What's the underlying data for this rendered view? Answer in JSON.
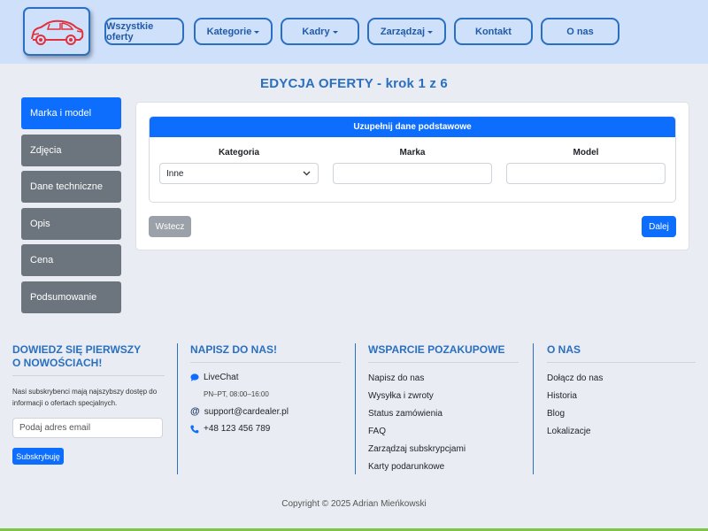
{
  "nav": {
    "items": [
      {
        "label": "Wszystkie oferty",
        "dropdown": false
      },
      {
        "label": "Kategorie",
        "dropdown": true
      },
      {
        "label": "Kadry",
        "dropdown": true
      },
      {
        "label": "Zarządzaj",
        "dropdown": true
      },
      {
        "label": "Kontakt",
        "dropdown": false
      },
      {
        "label": "O nas",
        "dropdown": false
      }
    ]
  },
  "page": {
    "title": "EDYCJA OFERTY - krok 1 z 6"
  },
  "steps": [
    {
      "label": "Marka i model",
      "active": true
    },
    {
      "label": "Zdjęcia",
      "active": false
    },
    {
      "label": "Dane techniczne",
      "active": false
    },
    {
      "label": "Opis",
      "active": false
    },
    {
      "label": "Cena",
      "active": false
    },
    {
      "label": "Podsumowanie",
      "active": false
    }
  ],
  "form": {
    "header": "Uzupełnij dane podstawowe",
    "category_label": "Kategoria",
    "category_value": "Inne",
    "brand_label": "Marka",
    "brand_value": "",
    "model_label": "Model",
    "model_value": "",
    "back_button": "Wstecz",
    "next_button": "Dalej"
  },
  "footer": {
    "newsletter": {
      "title_line1": "DOWIEDZ SIĘ PIERWSZY",
      "title_line2": "O NOWOŚCIACH!",
      "text": "Nasi subskrybenci mają najszybszy dostęp do informacji o ofertach specjalnych.",
      "placeholder": "Podaj adres email",
      "button": "Subskrybuję"
    },
    "contact": {
      "title": "NAPISZ DO NAS!",
      "livechat": "LiveChat",
      "hours": "PN–PT, 08:00–16:00",
      "email": "support@cardealer.pl",
      "phone": "+48 123 456 789"
    },
    "support": {
      "title": "WSPARCIE POZAKUPOWE",
      "links": [
        "Napisz do nas",
        "Wysyłka i zwroty",
        "Status zamówienia",
        "FAQ",
        "Zarządzaj subskrypcjami",
        "Karty podarunkowe"
      ]
    },
    "about": {
      "title": "O NAS",
      "links": [
        "Dołącz do nas",
        "Historia",
        "Blog",
        "Lokalizacje"
      ]
    },
    "copyright": "Copyright © 2025 Adrian Mieńkowski"
  },
  "colors": {
    "accent": "#0d6efd",
    "brand_blue": "#2a6fc0",
    "header_bg": "#cfe0fb",
    "step_inactive": "#6c757d",
    "logo_car": "#e0323c"
  }
}
